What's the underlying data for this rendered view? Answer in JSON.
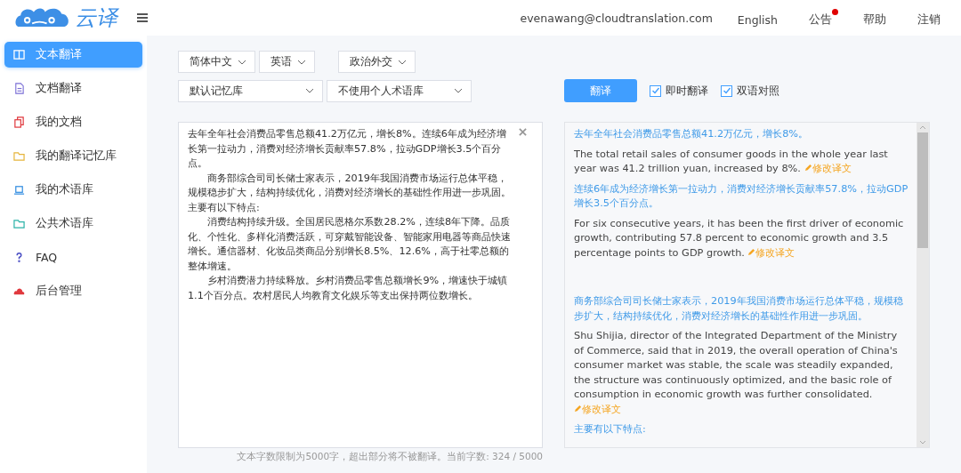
{
  "header": {
    "logo_text": "云译",
    "user_email": "evenawang@cloudtranslation.com",
    "nav": [
      {
        "label": "English",
        "notification": false
      },
      {
        "label": "公告",
        "notification": true
      },
      {
        "label": "帮助",
        "notification": false
      },
      {
        "label": "注销",
        "notification": false
      }
    ]
  },
  "sidebar": {
    "items": [
      {
        "label": "文本翻译",
        "selected": true
      },
      {
        "label": "文档翻译",
        "selected": false
      },
      {
        "label": "我的文档",
        "selected": false
      },
      {
        "label": "我的翻译记忆库",
        "selected": false
      },
      {
        "label": "我的术语库",
        "selected": false
      },
      {
        "label": "公共术语库",
        "selected": false
      },
      {
        "label": "FAQ",
        "selected": false
      },
      {
        "label": "后台管理",
        "selected": false
      }
    ]
  },
  "toolbar": {
    "source_language": "简体中文",
    "target_language": "英语",
    "domain": "政治外交",
    "memory": "默认记忆库",
    "termbase": "不使用个人术语库",
    "translate_button": "翻译",
    "options": [
      {
        "label": "即时翻译",
        "checked": true
      },
      {
        "label": "双语对照",
        "checked": true
      }
    ]
  },
  "source": {
    "paragraphs": [
      {
        "text": "去年全年社会消费品零售总额41.2万亿元，增长8%。连续6年成为经济增长第一拉动力，消费对经济增长贡献率57.8%，拉动GDP增长3.5个百分点。",
        "indented": false
      },
      {
        "text": "商务部综合司司长储士家表示，2019年我国消费市场运行总体平稳，规模稳步扩大，结构持续优化，消费对经济增长的基础性作用进一步巩固。主要有以下特点:",
        "indented": true
      },
      {
        "text": "消费结构持续升级。全国居民恩格尔系数28.2%，连续8年下降。品质化、个性化、多样化消费活跃，可穿戴智能设备、智能家用电器等商品快速增长。通信器材、化妆品类商品分别增长8.5%、12.6%，高于社零总额的整体增速。",
        "indented": true
      },
      {
        "text": "乡村消费潜力持续释放。乡村消费品零售总额增长9%，增速快于城镇1.1个百分点。农村居民人均教育文化娱乐等支出保持两位数增长。",
        "indented": true
      }
    ],
    "char_limit_note": "文本字数限制为5000字，超出部分将不被翻译。当前字数: 324 / 5000"
  },
  "result": {
    "segments": [
      {
        "source": "去年全年社会消费品零售总额41.2万亿元，增长8%。",
        "translation": "The total retail sales of consumer goods in the whole year last year was 41.2 trillion yuan, increased by 8%.",
        "edit_link": "修改译文"
      },
      {
        "source": "连续6年成为经济增长第一拉动力，消费对经济增长贡献率57.8%，拉动GDP增长3.5个百分点。",
        "translation": "For six consecutive years, it has been the first driver of economic growth, contributing 57.8 percent to economic growth and 3.5 percentage points to GDP growth.",
        "edit_link": "修改译文"
      },
      {
        "source": "商务部综合司司长储士家表示，2019年我国消费市场运行总体平稳，规模稳步扩大，结构持续优化，消费对经济增长的基础性作用进一步巩固。",
        "translation": "Shu Shijia, director of the Integrated Department of the Ministry of Commerce, said that in 2019, the overall operation of China's consumer market was stable, the scale was steadily expanded, the structure was continuously optimized, and the basic role of consumption in economic growth was further consolidated.",
        "edit_link": "修改译文"
      },
      {
        "source": "主要有以下特点:"
      }
    ]
  }
}
